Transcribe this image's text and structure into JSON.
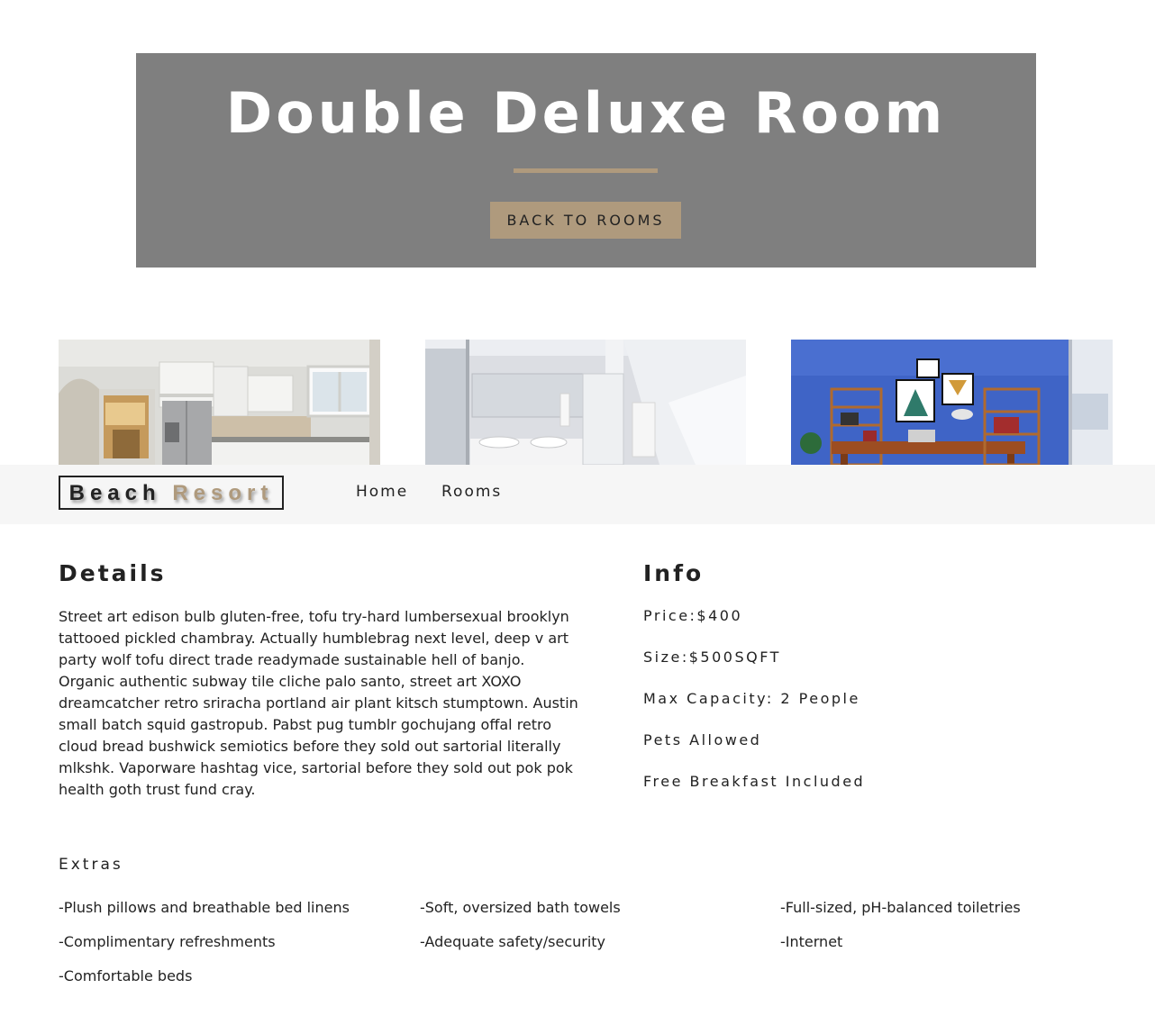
{
  "hero": {
    "title": "Double Deluxe Room",
    "back_button_label": "BACK TO ROOMS"
  },
  "gallery": {
    "images": [
      {
        "name": "kitchen-photo"
      },
      {
        "name": "bathroom-photo"
      },
      {
        "name": "office-photo"
      }
    ]
  },
  "navbar": {
    "logo_word1": "Beach",
    "logo_word2": "Resort",
    "links": [
      "Home",
      "Rooms"
    ]
  },
  "details": {
    "title": "Details",
    "text": "Street art edison bulb gluten-free, tofu try-hard lumbersexual brooklyn tattooed pickled chambray. Actually humblebrag next level, deep v art party wolf tofu direct trade readymade sustainable hell of banjo. Organic authentic subway tile cliche palo santo, street art XOXO dreamcatcher retro sriracha portland air plant kitsch stumptown. Austin small batch squid gastropub. Pabst pug tumblr gochujang offal retro cloud bread bushwick semiotics before they sold out sartorial literally mlkshk. Vaporware hashtag vice, sartorial before they sold out pok pok health goth trust fund cray."
  },
  "info": {
    "title": "Info",
    "items": [
      "Price:$400",
      "Size:$500SQFT",
      "Max Capacity: 2 People",
      "Pets Allowed",
      "Free Breakfast Included"
    ]
  },
  "extras": {
    "title": "Extras",
    "items": [
      "-Plush pillows and breathable bed linens",
      "-Soft, oversized bath towels",
      "-Full-sized, pH-balanced toiletries",
      "-Complimentary refreshments",
      "-Adequate safety/security",
      "-Internet",
      "-Comfortable beds"
    ]
  },
  "colors": {
    "accent": "#af9a7d",
    "hero_bg": "#7f7f7f",
    "navbar_bg": "#f6f6f6",
    "text": "#222222"
  }
}
